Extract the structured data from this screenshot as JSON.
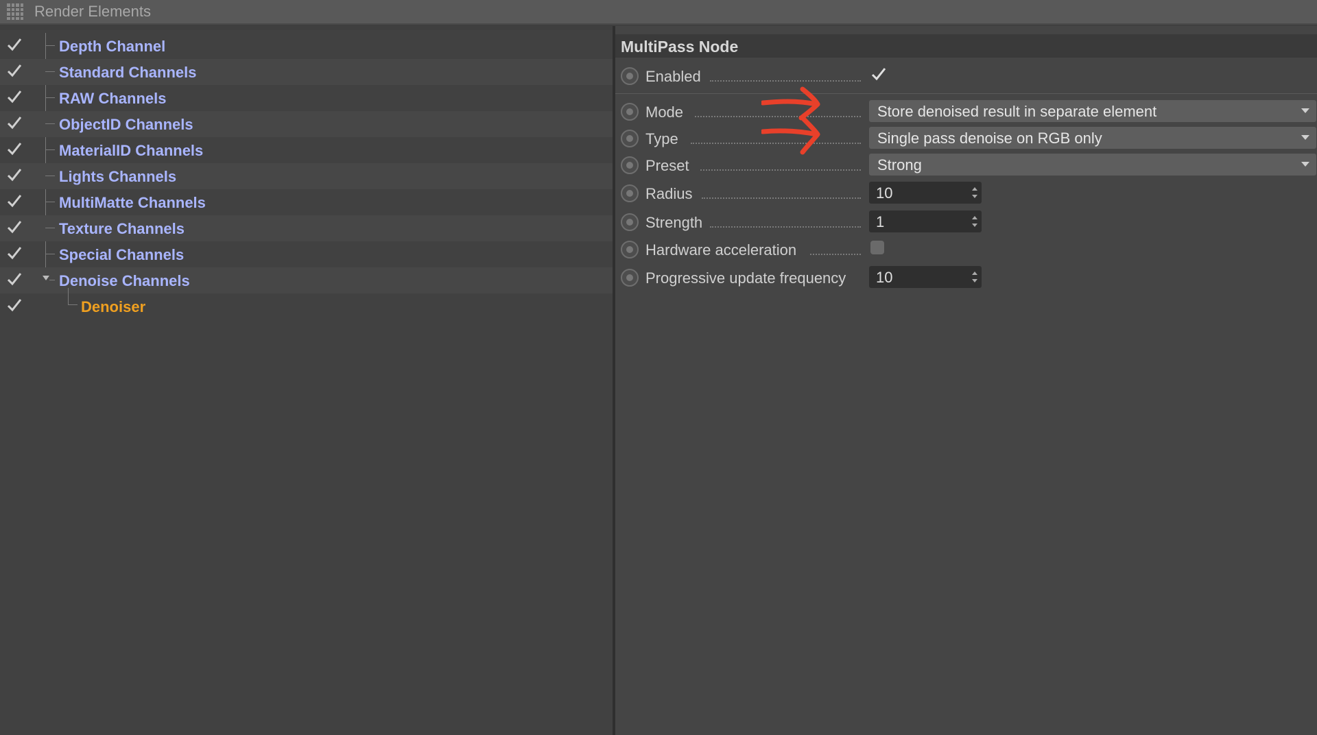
{
  "window": {
    "title": "Render Elements",
    "title_icon": "grid-icon"
  },
  "tree": {
    "items": [
      {
        "label": "Depth Channel",
        "checked": true
      },
      {
        "label": "Standard Channels",
        "checked": true
      },
      {
        "label": "RAW Channels",
        "checked": true
      },
      {
        "label": "ObjectID Channels",
        "checked": true
      },
      {
        "label": "MaterialID Channels",
        "checked": true
      },
      {
        "label": "Lights Channels",
        "checked": true
      },
      {
        "label": "MultiMatte Channels",
        "checked": true
      },
      {
        "label": "Texture Channels",
        "checked": true
      },
      {
        "label": "Special Channels",
        "checked": true
      },
      {
        "label": "Denoise Channels",
        "checked": true,
        "expanded": true
      },
      {
        "label": "Denoiser",
        "checked": true,
        "child": true,
        "selected": true
      }
    ],
    "colors": {
      "item": "#a9b5ff",
      "child_item": "#f0a020"
    }
  },
  "panel": {
    "title": "MultiPass Node",
    "enabled": {
      "label": "Enabled",
      "checked": true
    },
    "mode": {
      "label": "Mode",
      "value": "Store denoised result in separate element"
    },
    "type": {
      "label": "Type",
      "value": "Single pass denoise on RGB only"
    },
    "preset": {
      "label": "Preset",
      "value": "Strong"
    },
    "radius": {
      "label": "Radius",
      "value": "10"
    },
    "strength": {
      "label": "Strength",
      "value": "1"
    },
    "hardware_acceleration": {
      "label": "Hardware acceleration",
      "checked": false
    },
    "progressive_update_frequency": {
      "label": "Progressive update frequency",
      "value": "10"
    }
  },
  "annotation": {
    "icon": "red-arrows-annotation",
    "color": "#e8402a"
  }
}
